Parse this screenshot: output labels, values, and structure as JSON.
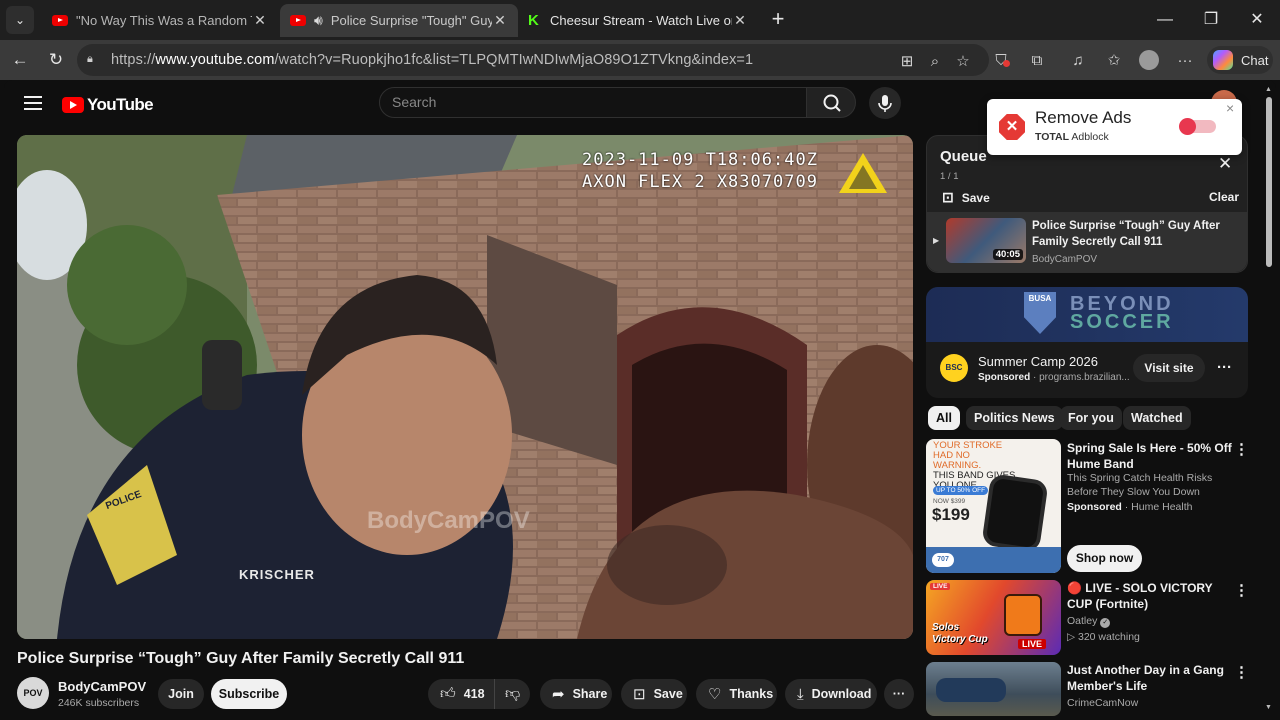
{
  "tabs": [
    {
      "title": "\"No Way This Was a Random Traffic",
      "close": "✕"
    },
    {
      "title": "Police Surprise \"Tough\" Guy After",
      "close": "✕"
    },
    {
      "title": "Cheesur Stream - Watch Live on Kick",
      "close": "✕"
    }
  ],
  "window_controls": {
    "minimize": "—",
    "maximize": "❐",
    "close": "✕"
  },
  "address": {
    "prefix": "https://",
    "host": "www.youtube.com",
    "path": "/watch?v=Ruopkjho1fc&list=TLPQMTIwNDIwMjaO89O1ZTVkng&index=1"
  },
  "toolbar": {
    "chat_label": "Chat"
  },
  "youtube": {
    "logo_text": "YouTube",
    "search_placeholder": "Search"
  },
  "video": {
    "timestamp_line1": "2023-11-09 T18:06:40Z",
    "timestamp_line2": "AXON FLEX 2 X83070709",
    "watermark": "BodyCamPOV",
    "badge_text": "KRISCHER",
    "patch_text": "POLICE",
    "title": "Police Surprise “Tough” Guy After Family Secretly Call 911"
  },
  "channel": {
    "name": "BodyCamPOV",
    "subscribers": "246K subscribers",
    "avatar_text": "POV",
    "join_label": "Join",
    "subscribe_label": "Subscribe"
  },
  "actions": {
    "likes": "418",
    "share": "Share",
    "save": "Save",
    "thanks": "Thanks",
    "download": "Download"
  },
  "queue": {
    "title": "Queue",
    "count": "1 / 1",
    "save": "Save",
    "clear": "Clear",
    "item": {
      "title": "Police Surprise “Tough” Guy After Family Secretly Call 911",
      "channel": "BodyCamPOV",
      "duration": "40:05"
    }
  },
  "ad": {
    "banner_text1": "BEYOND",
    "banner_text2": "SOCCER",
    "banner_logo": "BUSA",
    "title": "Summer Camp 2026",
    "sponsored": "Sponsored",
    "domain": "· programs.brazilian...",
    "cta": "Visit site",
    "logo_text": "BSC"
  },
  "chips": [
    "All",
    "Politics News",
    "For you",
    "Watched"
  ],
  "recommendations": [
    {
      "title": "Spring Sale Is Here - 50% Off Hume Band",
      "desc": "This Spring Catch Health Risks Before They Slow You Down",
      "sponsored": "Sponsored",
      "advertiser": "· Hume Health",
      "cta": "Shop now",
      "thumb_line1": "YOUR STROKE",
      "thumb_line2": "HAD NO WARNING.",
      "thumb_line3": "THIS BAND GIVES",
      "thumb_line4": "YOU ONE.",
      "thumb_badge": "UP TO 50% OFF",
      "thumb_was": "NOW $399",
      "thumb_price": "$199",
      "thumb_stat": "707"
    },
    {
      "title": "🔴 LIVE - SOLO VICTORY CUP (Fortnite)",
      "channel": "Oatley",
      "watching": "▷ 320 watching",
      "thumb_live_top": "LIVE",
      "thumb_text": "Solos Victory Cup",
      "live_badge": "LIVE"
    },
    {
      "title": "Just Another Day in a Gang Member's Life",
      "channel": "CrimeCamNow"
    }
  ],
  "adblock": {
    "title": "Remove Ads",
    "brand": "TOTAL",
    "product": "Adblock",
    "close": "×"
  }
}
